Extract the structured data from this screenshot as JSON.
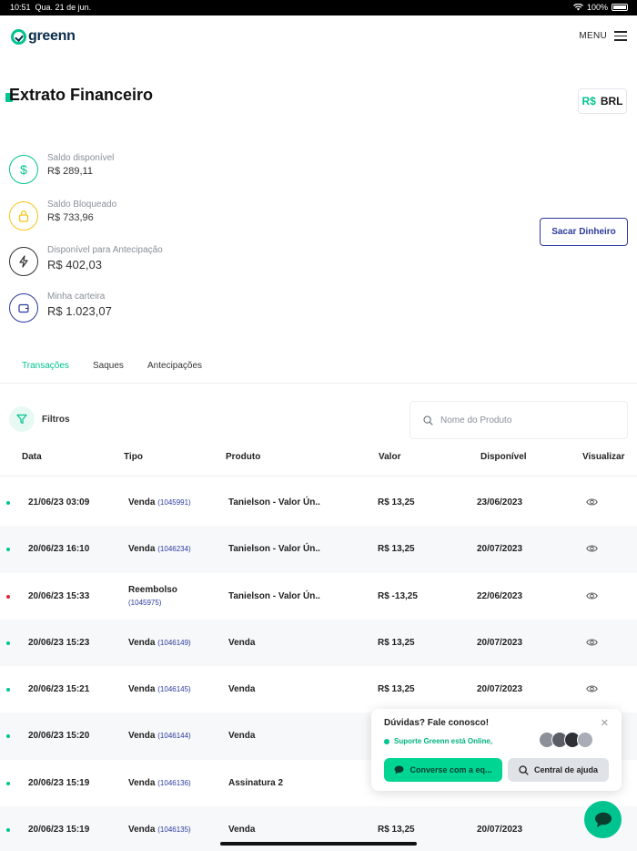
{
  "status_bar": {
    "time": "10:51",
    "date": "Qua. 21 de jun.",
    "battery": "100%"
  },
  "brand": {
    "name": "greenn",
    "accent": "#00c48f",
    "navy": "#2a3a9c"
  },
  "header": {
    "menu_label": "MENU"
  },
  "page": {
    "title": "Extrato Financeiro",
    "currency_symbol": "R$",
    "currency_code": "BRL"
  },
  "balances": [
    {
      "label": "Saldo disponível",
      "value": "R$ 289,11",
      "icon": "dollar-icon",
      "color": "#00c48f"
    },
    {
      "label": "Saldo Bloqueado",
      "value": "R$ 733,96",
      "icon": "lock-icon",
      "color": "#f5c518"
    },
    {
      "label": "Disponível para Antecipação",
      "value": "R$ 402,03",
      "icon": "lightning-icon",
      "color": "#333333"
    },
    {
      "label": "Minha carteira",
      "value": "R$ 1.023,07",
      "icon": "wallet-icon",
      "color": "#2a3a9c"
    }
  ],
  "withdraw_button": "Sacar Dinheiro",
  "tabs": [
    {
      "label": "Transações",
      "active": true
    },
    {
      "label": "Saques",
      "active": false
    },
    {
      "label": "Antecipações",
      "active": false
    }
  ],
  "filters": {
    "label": "Filtros",
    "search_placeholder": "Nome do Produto"
  },
  "table": {
    "columns": [
      "Data",
      "Tipo",
      "Produto",
      "Valor",
      "Disponível",
      "Visualizar"
    ],
    "rows": [
      {
        "status": "#00c48f",
        "date": "21/06/23 03:09",
        "type": "Venda",
        "id": "(1045991)",
        "product": "Tanielson - Valor Ún..",
        "value": "R$ 13,25",
        "available": "23/06/2023",
        "eye": true
      },
      {
        "status": "#00c48f",
        "date": "20/06/23 16:10",
        "type": "Venda",
        "id": "(1046234)",
        "product": "Tanielson - Valor Ún..",
        "value": "R$ 13,25",
        "available": "20/07/2023",
        "eye": true
      },
      {
        "status": "#e0243a",
        "date": "20/06/23 15:33",
        "type": "Reembolso",
        "id": "(1045975)",
        "product": "Tanielson - Valor Ún..",
        "value": "R$ -13,25",
        "available": "22/06/2023",
        "eye": true
      },
      {
        "status": "#00c48f",
        "date": "20/06/23 15:23",
        "type": "Venda",
        "id": "(1046149)",
        "product": "Venda",
        "value": "R$ 13,25",
        "available": "20/07/2023",
        "eye": true
      },
      {
        "status": "#00c48f",
        "date": "20/06/23 15:21",
        "type": "Venda",
        "id": "(1046145)",
        "product": "Venda",
        "value": "R$ 13,25",
        "available": "20/07/2023",
        "eye": true
      },
      {
        "status": "#00c48f",
        "date": "20/06/23 15:20",
        "type": "Venda",
        "id": "(1046144)",
        "product": "Venda",
        "value": "",
        "available": "",
        "eye": false
      },
      {
        "status": "#00c48f",
        "date": "20/06/23 15:19",
        "type": "Venda",
        "id": "(1046136)",
        "product": "Assinatura 2",
        "value": "",
        "available": "",
        "eye": false
      },
      {
        "status": "#00c48f",
        "date": "20/06/23 15:19",
        "type": "Venda",
        "id": "(1046135)",
        "product": "Venda",
        "value": "R$ 13,25",
        "available": "20/07/2023",
        "eye": false
      }
    ]
  },
  "chat_widget": {
    "title": "Dúvidas? Fale conosco!",
    "online_text": "Suporte Greenn está Online,",
    "chat_button": "Converse com a eq...",
    "help_button": "Central de ajuda"
  }
}
